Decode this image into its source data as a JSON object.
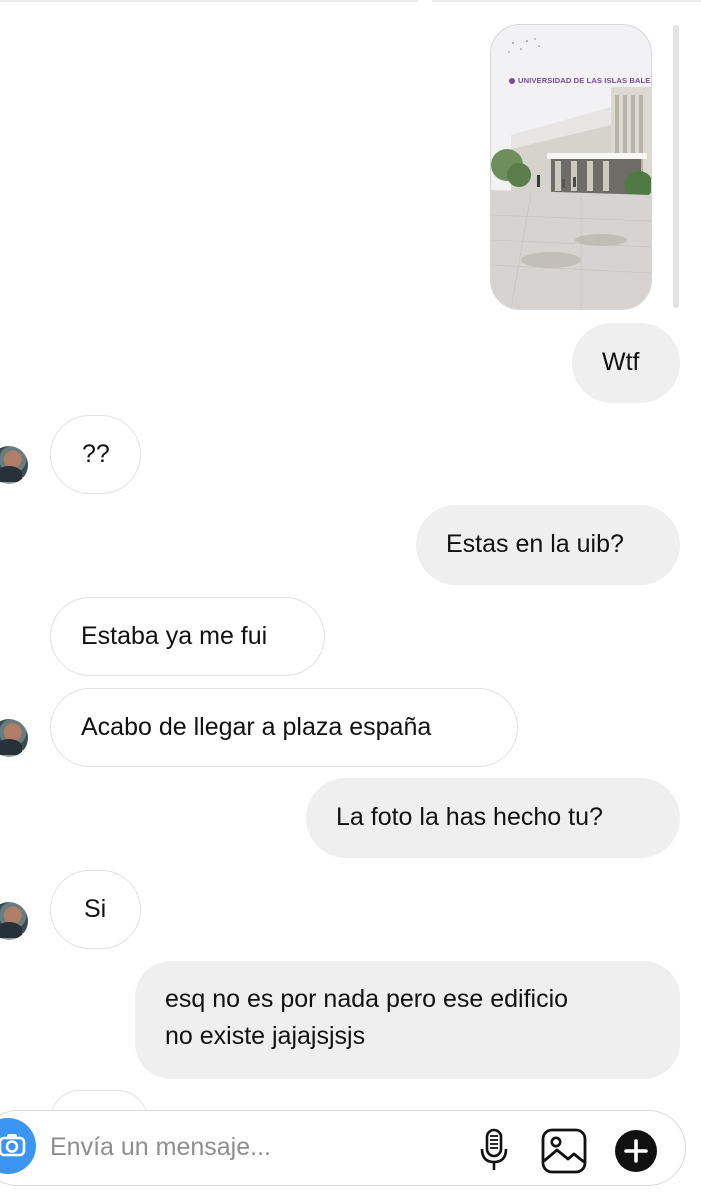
{
  "shared_story": {
    "caption": "UNIVERSIDAD DE LAS ISLAS BALEARES"
  },
  "messages": [
    {
      "sender": "me",
      "text": "Wtf"
    },
    {
      "sender": "them",
      "text": "??"
    },
    {
      "sender": "me",
      "text": "Estas en la uib?"
    },
    {
      "sender": "them",
      "text": "Estaba ya me fui"
    },
    {
      "sender": "them",
      "text": "Acabo de llegar a plaza españa"
    },
    {
      "sender": "me",
      "text": "La foto la has hecho tu?"
    },
    {
      "sender": "them",
      "text": "Si"
    },
    {
      "sender": "me",
      "text": "esq no es por nada pero ese edificio",
      "line2": "no existe jajajsjsjs"
    }
  ],
  "composer": {
    "placeholder": "Envía un mensaje..."
  },
  "colors": {
    "outgoing_bubble": "#efefef",
    "incoming_bubble_border": "#e2e2e2",
    "camera_button": "#3b95f2",
    "caption": "#7b4aa0"
  },
  "icons": {
    "camera": "camera-icon",
    "mic": "microphone-icon",
    "gallery": "image-icon",
    "add": "plus-circle-icon"
  }
}
